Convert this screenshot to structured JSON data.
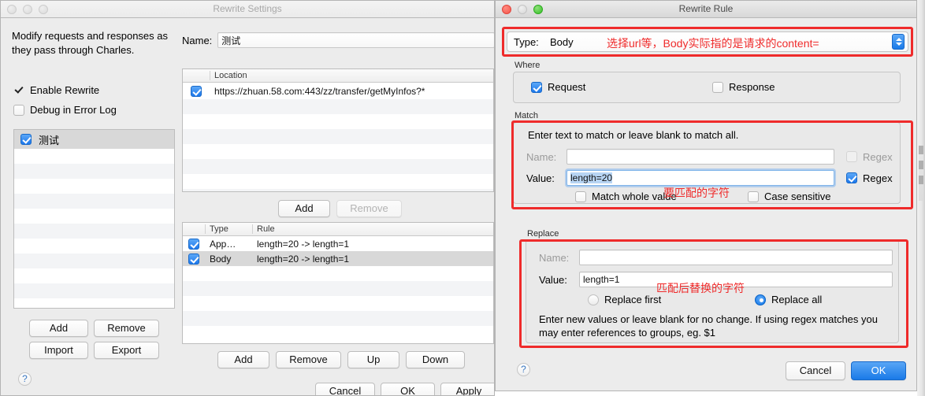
{
  "settings_window": {
    "title": "Rewrite Settings",
    "description": "Modify requests and responses as they pass through Charles.",
    "checkboxes": [
      {
        "label": "Enable Rewrite",
        "checked": true
      },
      {
        "label": "Debug in Error Log",
        "checked": false
      }
    ],
    "sets_list": {
      "items": [
        {
          "label": "测试",
          "checked": true,
          "selected": true
        }
      ]
    },
    "sets_buttons": [
      {
        "label": "Add",
        "enabled": true
      },
      {
        "label": "Remove",
        "enabled": true
      },
      {
        "label": "Import",
        "enabled": true
      },
      {
        "label": "Export",
        "enabled": true
      }
    ],
    "name_field": {
      "label": "Name:",
      "value": "测试",
      "placeholder": ""
    },
    "locations_table": {
      "columns": [
        "Location"
      ],
      "rows": [
        {
          "checked": true,
          "location": "https://zhuan.58.com:443/zz/transfer/getMyInfos?*"
        }
      ]
    },
    "locations_buttons": [
      {
        "label": "Add",
        "enabled": true
      },
      {
        "label": "Remove",
        "enabled": false
      }
    ],
    "rules_table": {
      "columns": [
        "Type",
        "Rule"
      ],
      "rows": [
        {
          "checked": true,
          "type": "App…",
          "rule": "length=20 -> length=1",
          "selected": false
        },
        {
          "checked": true,
          "type": "Body",
          "rule": "length=20 -> length=1",
          "selected": true
        }
      ]
    },
    "rules_buttons": [
      {
        "label": "Add",
        "enabled": true
      },
      {
        "label": "Remove",
        "enabled": true
      },
      {
        "label": "Up",
        "enabled": true
      },
      {
        "label": "Down",
        "enabled": true
      }
    ],
    "footer_buttons": [
      {
        "label": "Cancel",
        "primary": false
      },
      {
        "label": "OK",
        "primary": false
      },
      {
        "label": "Apply",
        "primary": false
      }
    ],
    "help_label": "?"
  },
  "rule_window": {
    "title": "Rewrite Rule",
    "type_row": {
      "label": "Type:",
      "value": "Body"
    },
    "where": {
      "group_label": "Where",
      "options": [
        {
          "label": "Request",
          "checked": true
        },
        {
          "label": "Response",
          "checked": false
        }
      ]
    },
    "match": {
      "group_label": "Match",
      "hint": "Enter text to match or leave blank to match all.",
      "name": {
        "label": "Name:",
        "value": "",
        "placeholder": ""
      },
      "name_regex": {
        "label": "Regex",
        "checked": false,
        "disabled": true
      },
      "value": {
        "label": "Value:",
        "value": "length=20",
        "selected": true
      },
      "value_regex": {
        "label": "Regex",
        "checked": true,
        "disabled": false
      },
      "match_whole": {
        "label": "Match whole value",
        "checked": false
      },
      "case_sensitive": {
        "label": "Case sensitive",
        "checked": false
      }
    },
    "replace": {
      "group_label": "Replace",
      "name": {
        "label": "Name:",
        "value": "",
        "placeholder": ""
      },
      "value": {
        "label": "Value:",
        "value": "length=1"
      },
      "radios": [
        {
          "label": "Replace first",
          "selected": false
        },
        {
          "label": "Replace all",
          "selected": true
        }
      ],
      "hint": "Enter new values or leave blank for no change. If using regex matches you may enter references to groups, eg. $1"
    },
    "footer_buttons": [
      {
        "label": "Cancel",
        "primary": false
      },
      {
        "label": "OK",
        "primary": true
      }
    ],
    "help_label": "?"
  },
  "annotations": {
    "color": "#ef2b2b",
    "type_note": "选择url等，Body实际指的是请求的content=",
    "match_note": "要匹配的字符",
    "replace_note": "匹配后替换的字符"
  }
}
